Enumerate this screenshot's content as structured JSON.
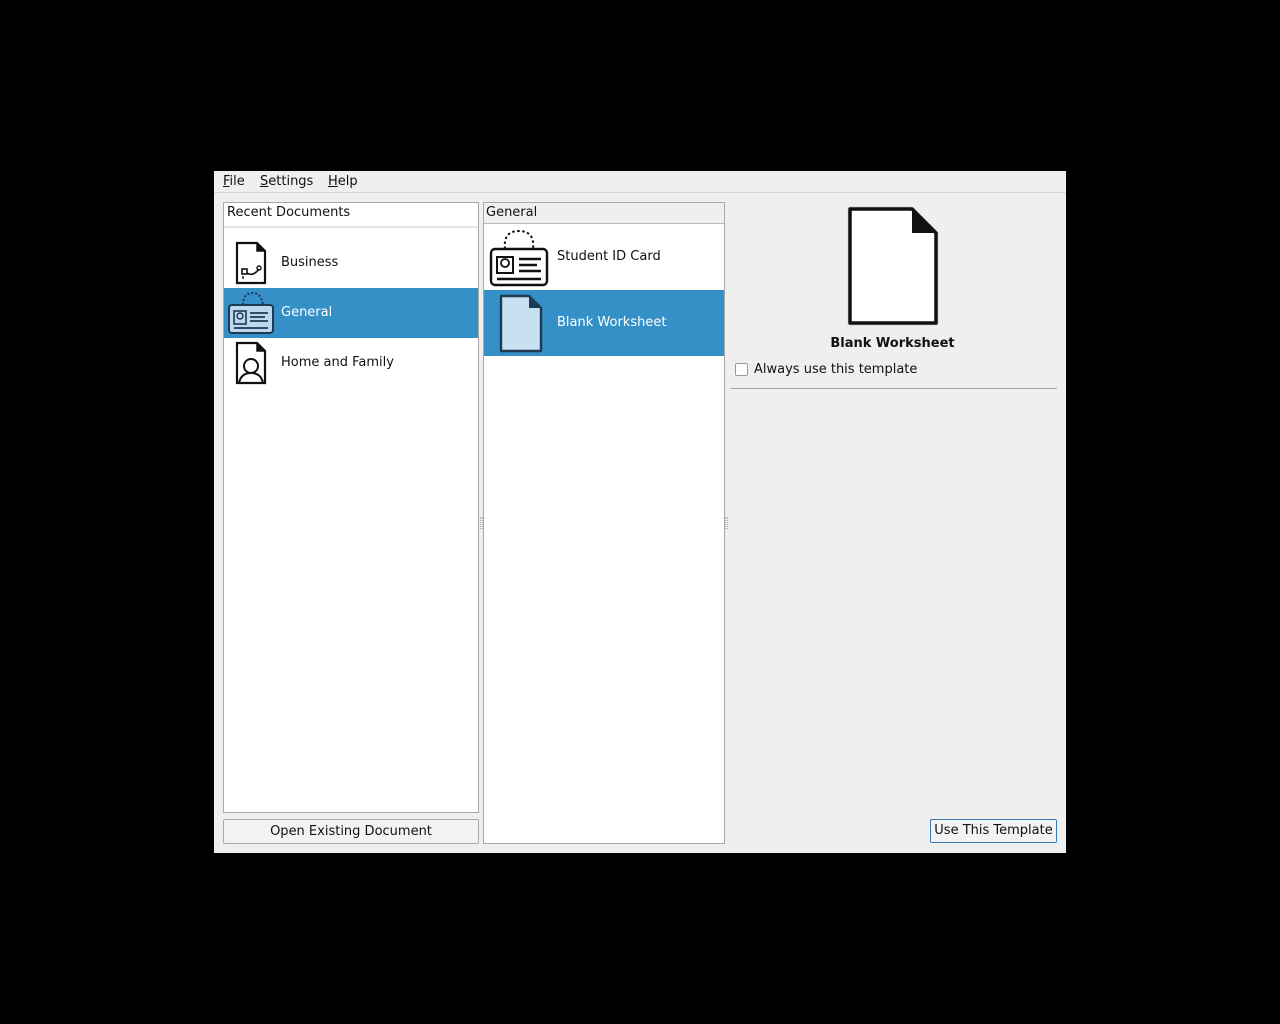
{
  "menubar": {
    "items": [
      {
        "mnemonic": "F",
        "rest": "ile"
      },
      {
        "mnemonic": "S",
        "rest": "ettings"
      },
      {
        "mnemonic": "H",
        "rest": "elp"
      }
    ]
  },
  "categories": {
    "header": "Recent Documents",
    "items": [
      {
        "label": "Business",
        "icon": "business-document-icon",
        "selected": false
      },
      {
        "label": "General",
        "icon": "id-card-icon",
        "selected": true
      },
      {
        "label": "Home and Family",
        "icon": "family-document-icon",
        "selected": false
      }
    ]
  },
  "open_button": "Open Existing Document",
  "templates": {
    "header": "General",
    "items": [
      {
        "label": "Student ID Card",
        "icon": "student-id-card-icon",
        "selected": false
      },
      {
        "label": "Blank Worksheet",
        "icon": "blank-document-icon",
        "selected": true
      }
    ]
  },
  "preview": {
    "title": "Blank Worksheet",
    "icon": "blank-document-icon",
    "always_use_label": "Always use this template",
    "always_use_checked": false
  },
  "use_button": "Use This Template",
  "colors": {
    "selection": "#3590c8",
    "window_bg": "#efefef"
  }
}
